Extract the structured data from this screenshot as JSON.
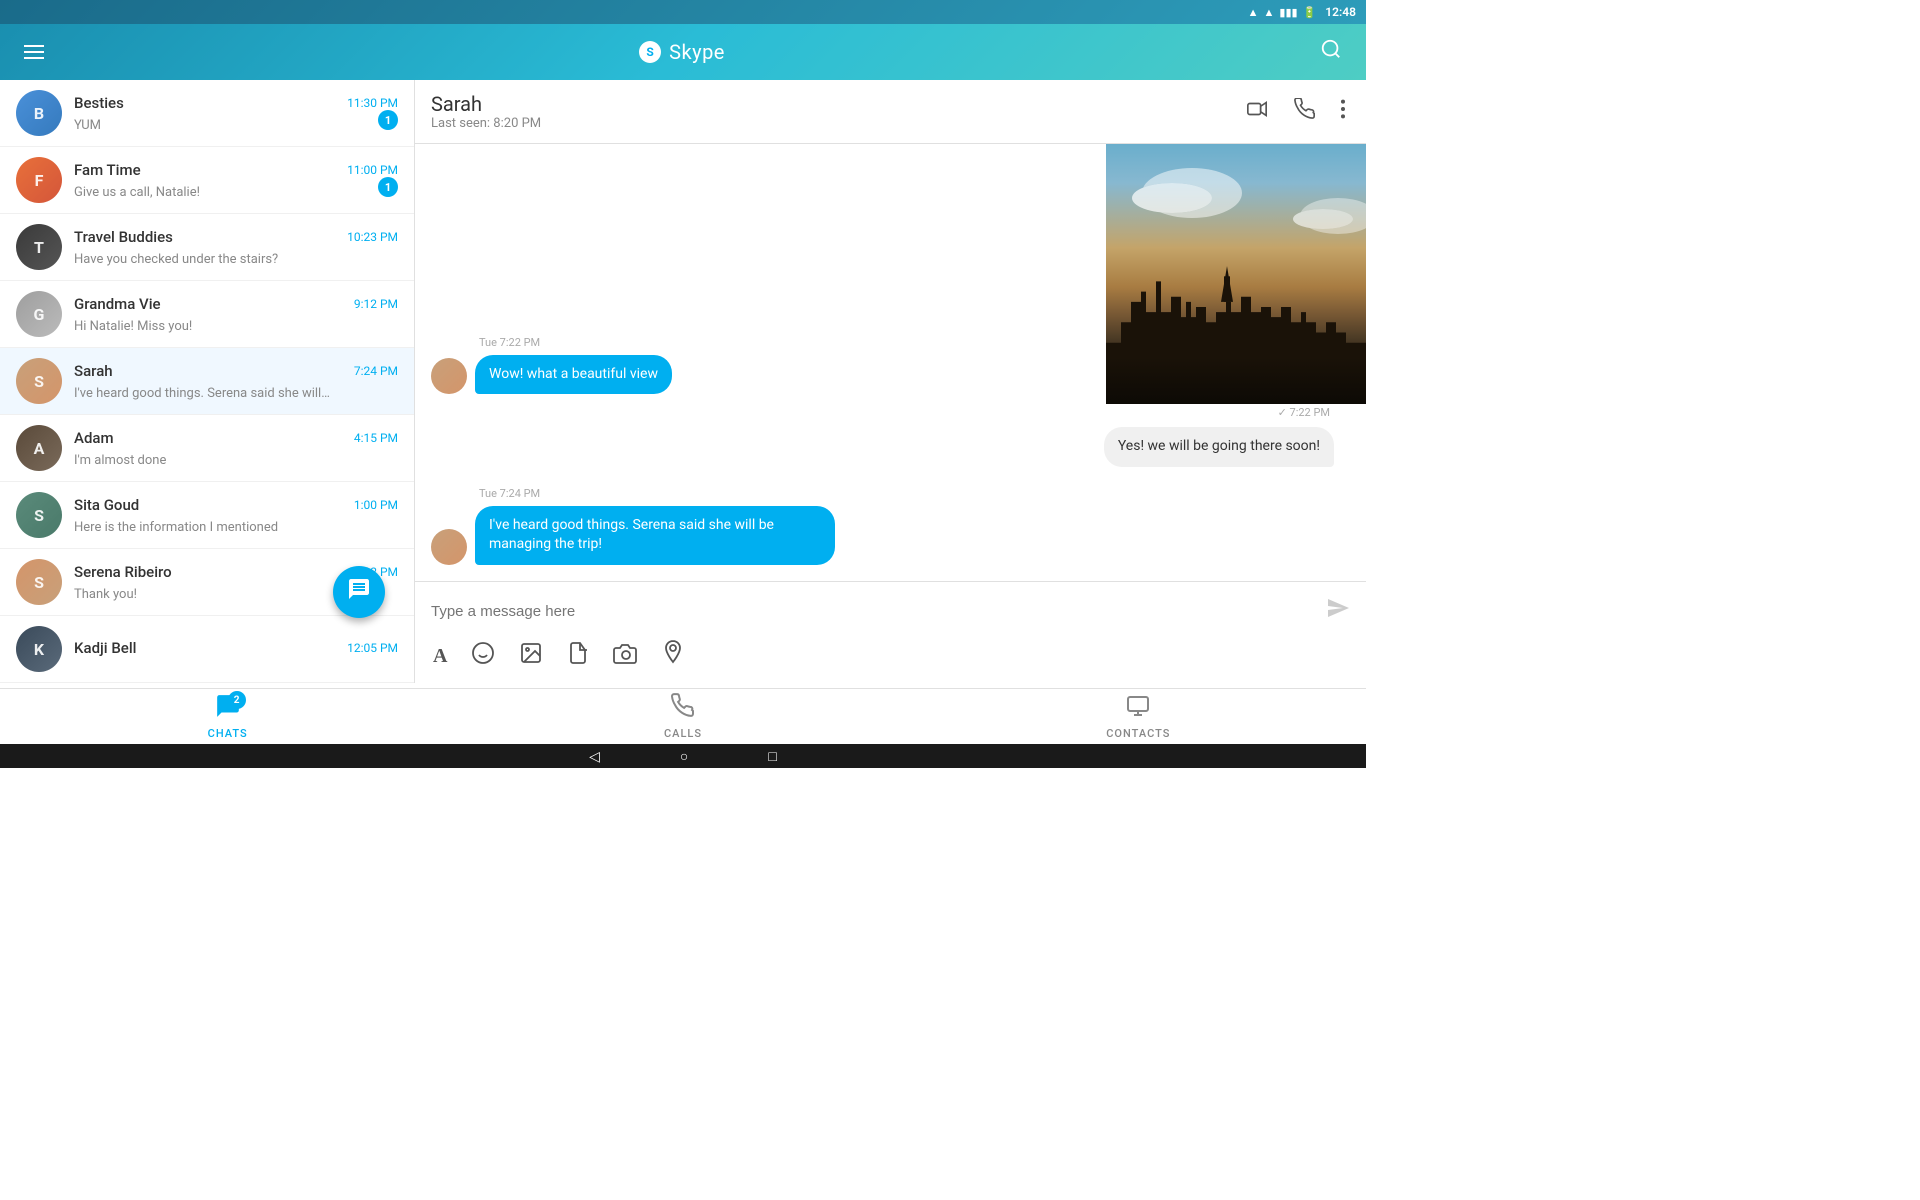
{
  "statusBar": {
    "time": "12:48",
    "wifi": "wifi",
    "signal": "signal",
    "battery": "battery"
  },
  "appBar": {
    "menuIcon": "≡",
    "appName": "Skype",
    "searchIcon": "🔍"
  },
  "chatList": {
    "items": [
      {
        "id": "besties",
        "name": "Besties",
        "preview": "YUM",
        "time": "11:30 PM",
        "badge": "1",
        "avatarColor": "av-blue",
        "avatarText": "B"
      },
      {
        "id": "fam-time",
        "name": "Fam Time",
        "preview": "Give us a call, Natalie!",
        "time": "11:00 PM",
        "badge": "1",
        "avatarColor": "av-orange",
        "avatarText": "F"
      },
      {
        "id": "travel-buddies",
        "name": "Travel Buddies",
        "preview": "Have you checked under the stairs?",
        "time": "10:23 PM",
        "badge": "",
        "avatarColor": "av-dark",
        "avatarText": "T"
      },
      {
        "id": "grandma-vie",
        "name": "Grandma Vie",
        "preview": "Hi Natalie! Miss you!",
        "time": "9:12 PM",
        "badge": "",
        "avatarColor": "av-gray",
        "avatarText": "G"
      },
      {
        "id": "sarah",
        "name": "Sarah",
        "preview": "I've heard good things. Serena said she will…",
        "time": "7:24 PM",
        "badge": "",
        "avatarColor": "av-orange",
        "avatarText": "S",
        "active": true
      },
      {
        "id": "adam",
        "name": "Adam",
        "preview": "I'm almost done",
        "time": "4:15 PM",
        "badge": "",
        "avatarColor": "av-dark",
        "avatarText": "A"
      },
      {
        "id": "sita-goud",
        "name": "Sita Goud",
        "preview": "Here is the information I mentioned",
        "time": "1:00 PM",
        "badge": "",
        "avatarColor": "av-blue",
        "avatarText": "S"
      },
      {
        "id": "serena-ribeiro",
        "name": "Serena Ribeiro",
        "preview": "Thank you!",
        "time": "12:12 PM",
        "badge": "",
        "avatarColor": "av-orange",
        "avatarText": "S"
      },
      {
        "id": "kadji-bell",
        "name": "Kadji Bell",
        "preview": "",
        "time": "12:05 PM",
        "badge": "",
        "avatarColor": "av-dark",
        "avatarText": "K"
      }
    ]
  },
  "chatHeader": {
    "name": "Sarah",
    "lastSeen": "Last seen: 8:20 PM"
  },
  "messages": [
    {
      "id": "msg1",
      "type": "incoming",
      "timestamp": "Tue 7:22 PM",
      "text": "Wow! what a beautiful view",
      "showAvatar": true
    },
    {
      "id": "msg2",
      "type": "outgoing",
      "timestamp": "✓ 7:22 PM",
      "text": "Yes! we will be going there soon!"
    },
    {
      "id": "msg3",
      "type": "incoming",
      "timestamp": "Tue 7:24 PM",
      "text": "I've heard good things. Serena said she will be managing the trip!",
      "showAvatar": true
    }
  ],
  "inputArea": {
    "placeholder": "Type a message here",
    "toolbar": {
      "text": "A",
      "emoji": "😊",
      "image": "🖼",
      "file": "📄",
      "camera": "📷",
      "location": "📍"
    }
  },
  "bottomNav": {
    "items": [
      {
        "id": "chats",
        "label": "CHATS",
        "icon": "💬",
        "active": true,
        "badge": "2"
      },
      {
        "id": "calls",
        "label": "CALLS",
        "icon": "📞",
        "active": false,
        "badge": ""
      },
      {
        "id": "contacts",
        "label": "CONTACTS",
        "icon": "👤",
        "active": false,
        "badge": ""
      }
    ]
  },
  "androidNav": {
    "back": "◁",
    "home": "○",
    "recent": "□"
  }
}
